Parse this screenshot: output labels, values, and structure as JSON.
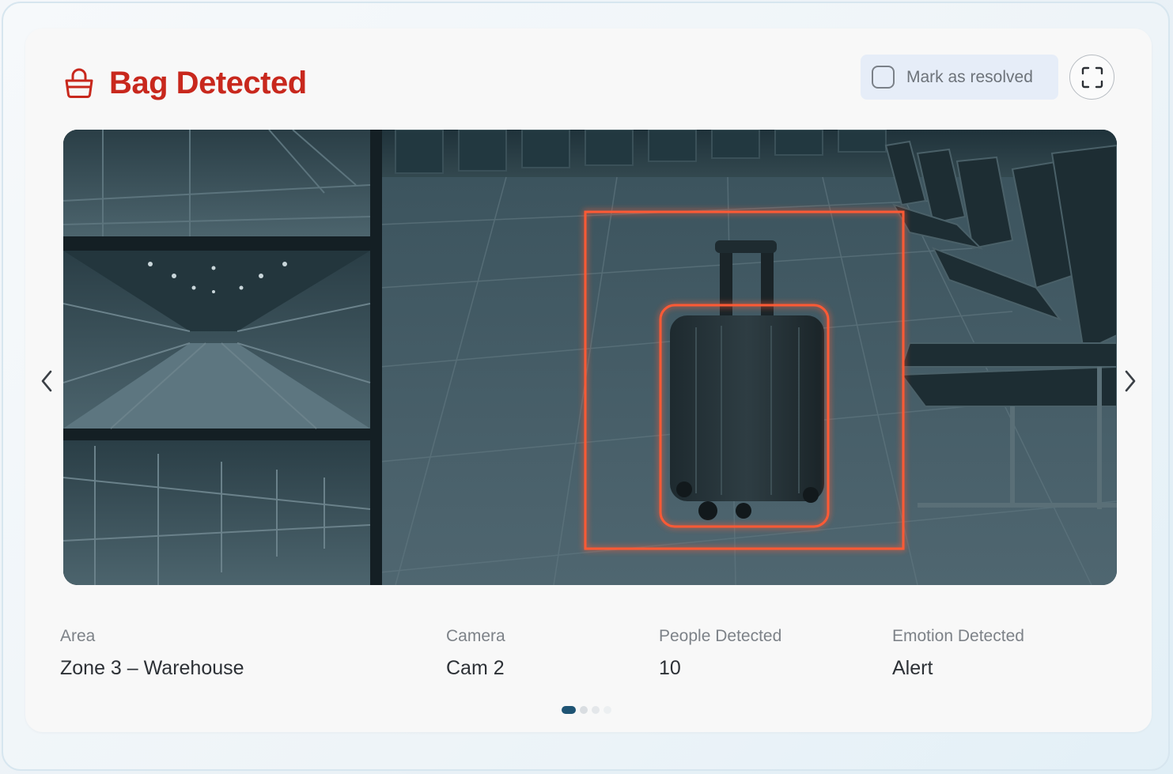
{
  "header": {
    "title": "Bag Detected",
    "icon": "bag-icon",
    "resolve_label": "Mark as resolved",
    "resolve_checked": false,
    "fullscreen_icon": "fullscreen-icon"
  },
  "viewer": {
    "scene": "airport-waiting-area-suitcase",
    "prev_icon": "chevron-left-icon",
    "next_icon": "chevron-right-icon"
  },
  "details": [
    {
      "label": "Area",
      "value": "Zone 3 – Warehouse"
    },
    {
      "label": "Camera",
      "value": "Cam 2"
    },
    {
      "label": "People Detected",
      "value": "10"
    },
    {
      "label": "Emotion Detected",
      "value": "Alert"
    }
  ],
  "pagination": {
    "total": 4,
    "active": 1
  },
  "colors": {
    "alert": "#c8281d",
    "detection_box": "#ff5a36",
    "pagination_active": "#1f5474",
    "button_bg": "#e6edf8"
  }
}
